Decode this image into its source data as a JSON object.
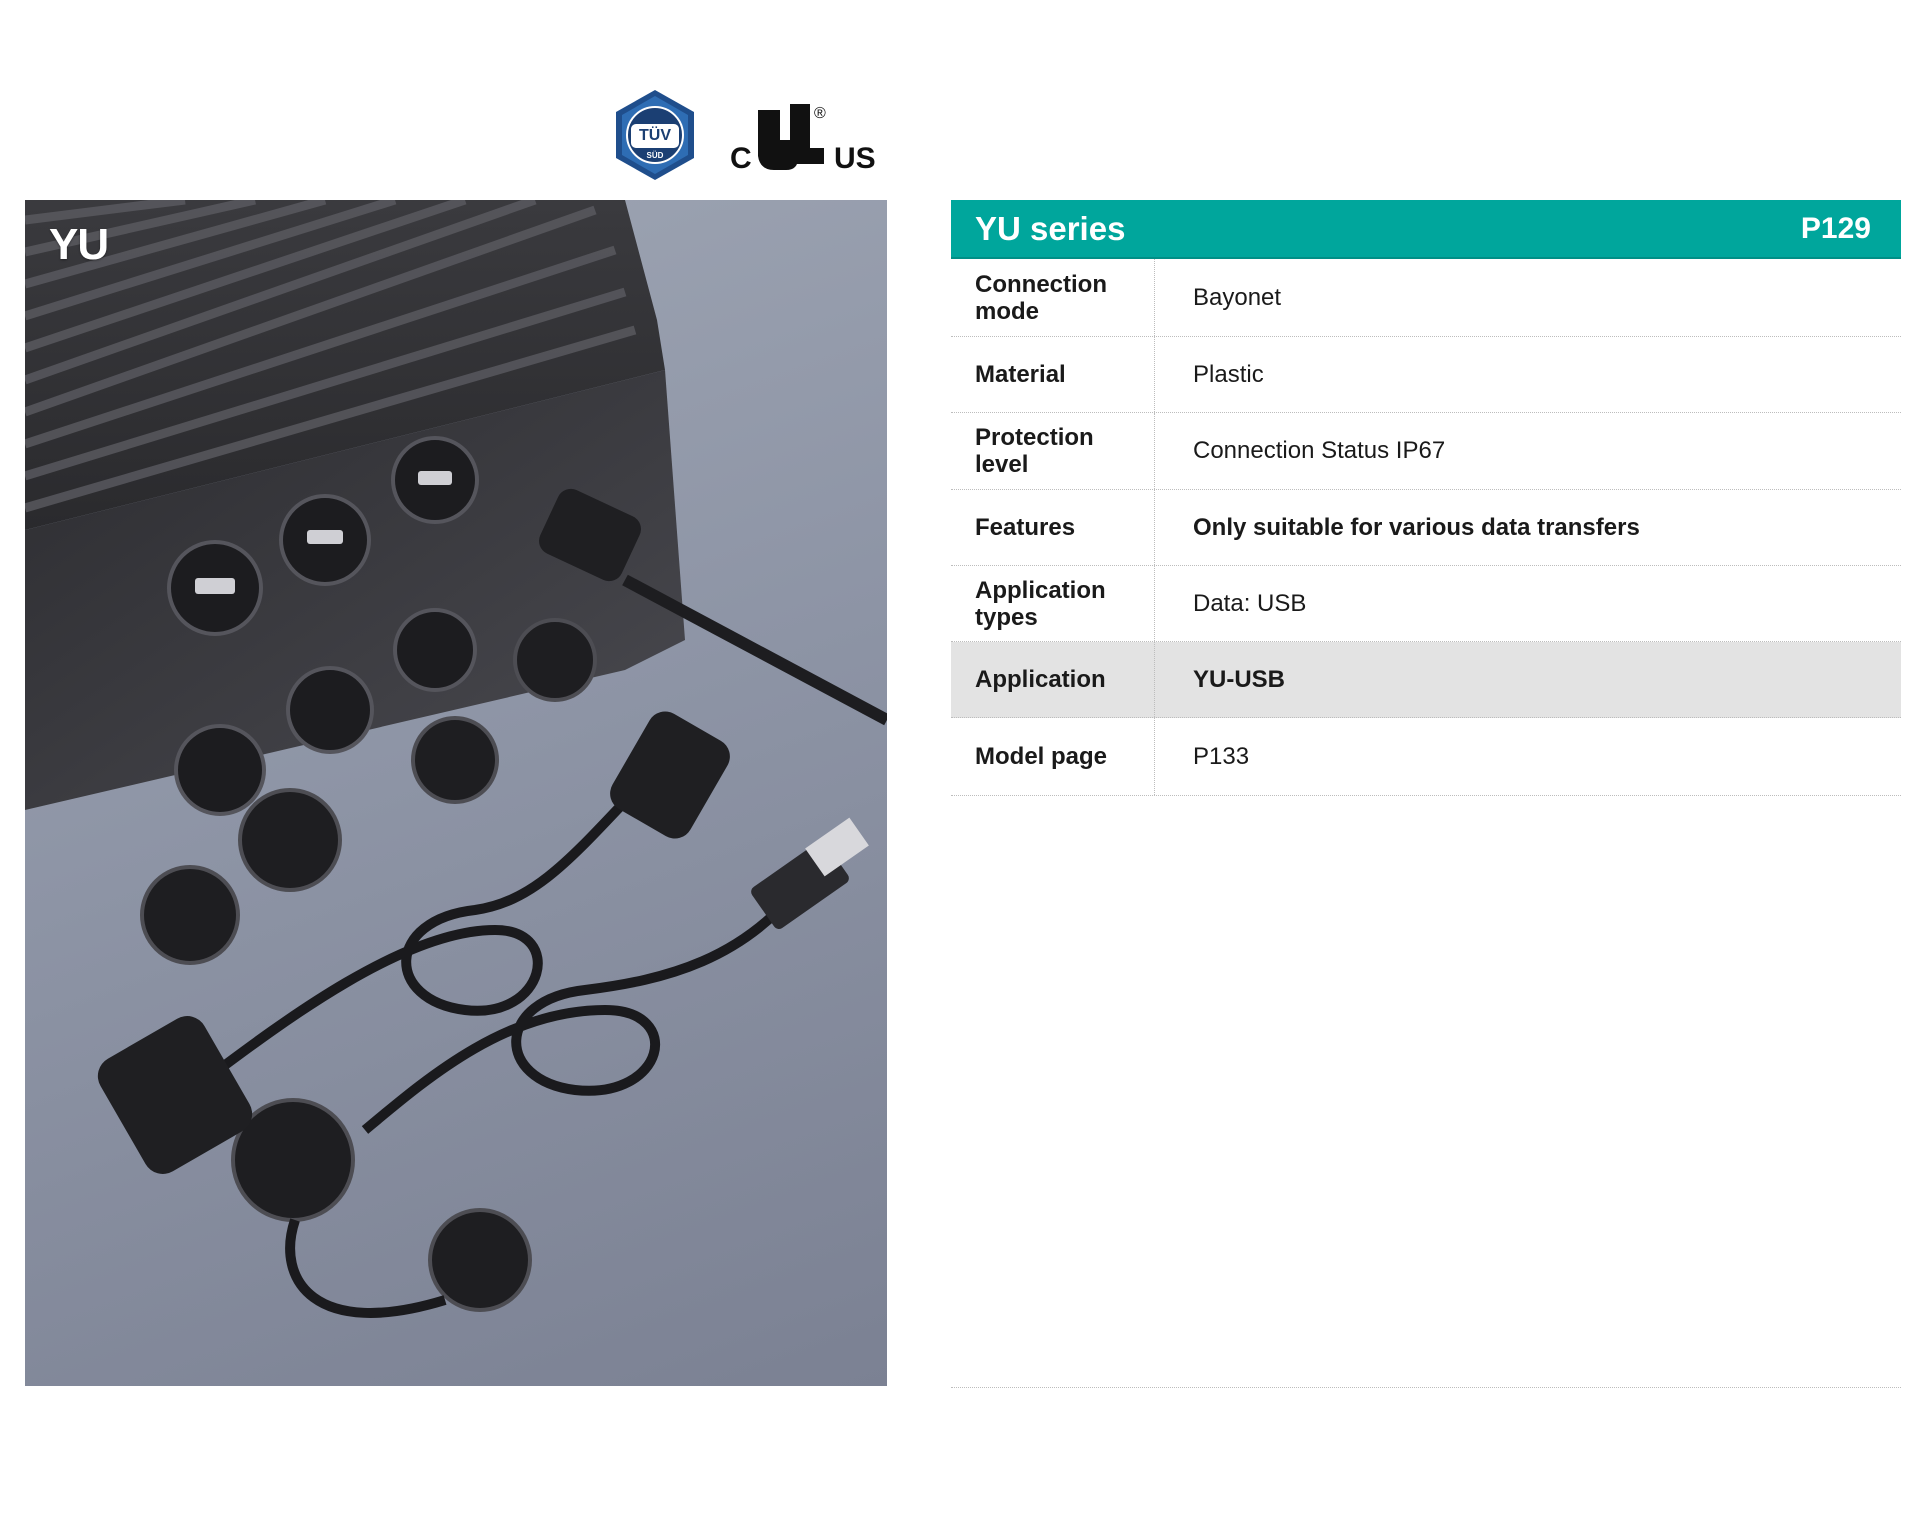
{
  "certifications": {
    "tuv_text": "TÜV",
    "tuv_sub": "SÜD",
    "ul_left": "C",
    "ul_mark": "UL",
    "ul_right": "US",
    "ul_registered": "®"
  },
  "photo": {
    "series_label": "YU"
  },
  "spec_table": {
    "title": "YU series",
    "page_ref": "P129",
    "accent_color": "#00a69c",
    "rows": [
      {
        "label": "Connection mode",
        "value": "Bayonet"
      },
      {
        "label": "Material",
        "value": "Plastic"
      },
      {
        "label": "Protection level",
        "value": "Connection Status IP67"
      },
      {
        "label": "Features",
        "value": "Only suitable for various data transfers"
      },
      {
        "label": "Application types",
        "value": "Data: USB"
      },
      {
        "label": "Application",
        "value": "YU-USB"
      },
      {
        "label": "Model page",
        "value": "P133"
      }
    ]
  }
}
